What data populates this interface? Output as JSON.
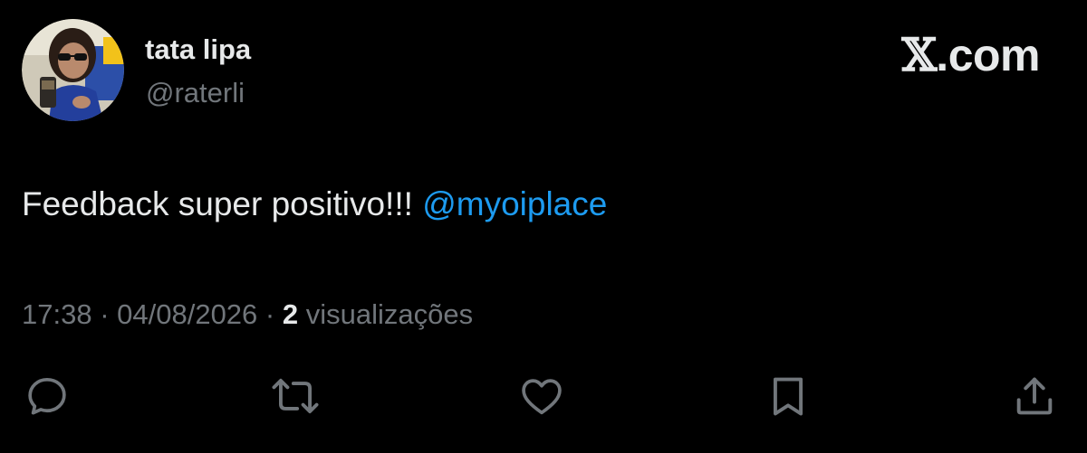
{
  "author": {
    "name": "tata lipa",
    "handle": "@raterli"
  },
  "brand": {
    "x": "𝕏",
    "domain": ".com"
  },
  "tweet": {
    "text": "Feedback super positivo!!! ",
    "mention": "@myoiplace"
  },
  "meta": {
    "time": "17:38",
    "separator": " · ",
    "date": "04/08/2026",
    "views_count": "2",
    "views_label": " visualizações"
  },
  "actions": {
    "reply_icon": "reply-icon",
    "repost_icon": "repost-icon",
    "like_icon": "heart-icon",
    "bookmark_icon": "bookmark-icon",
    "share_icon": "share-icon"
  },
  "colors": {
    "background": "#000000",
    "text": "#e7e9ea",
    "secondary": "#71767b",
    "link": "#1d9bf0"
  }
}
